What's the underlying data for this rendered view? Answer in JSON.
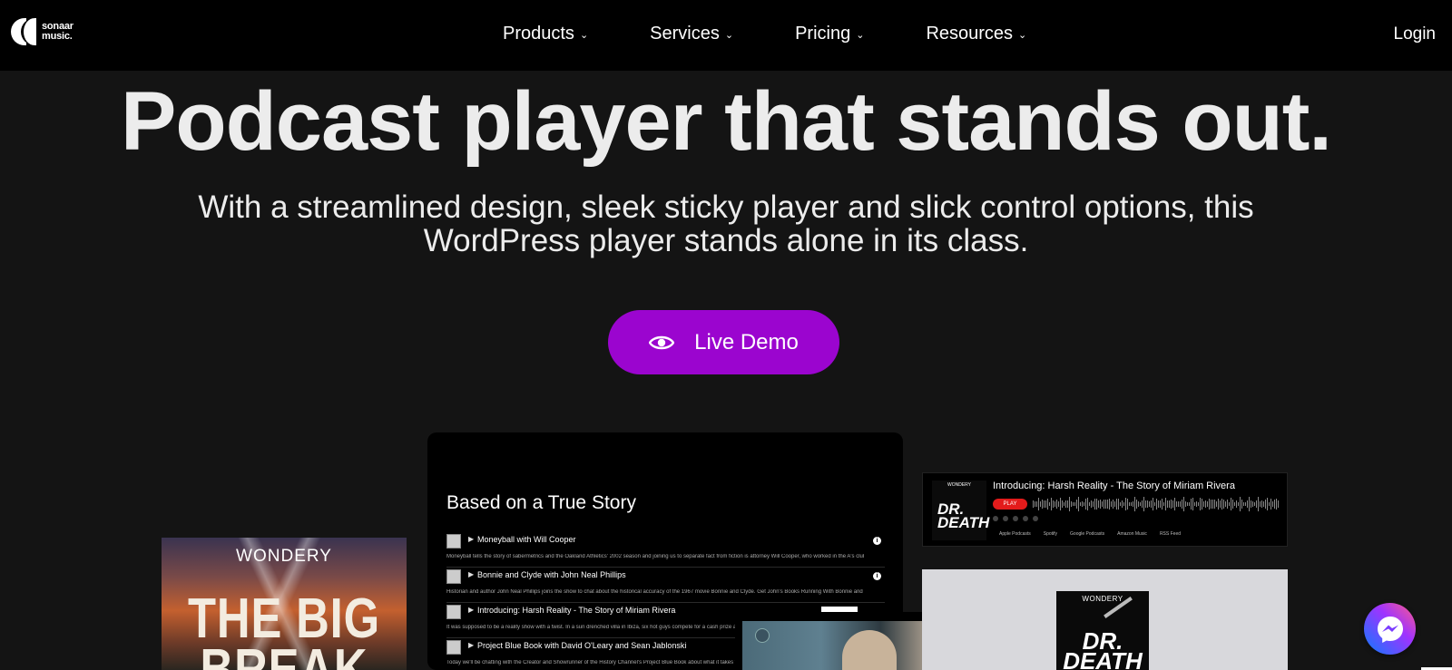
{
  "brand": {
    "name_line1": "sonaar",
    "name_line2": "music."
  },
  "nav": {
    "items": [
      {
        "label": "Products"
      },
      {
        "label": "Services"
      },
      {
        "label": "Pricing"
      },
      {
        "label": "Resources"
      }
    ],
    "login_label": "Login"
  },
  "hero": {
    "title": "Podcast player that stands out.",
    "subtitle_line1": "With a streamlined design, sleek sticky player and slick control options, this",
    "subtitle_line2": "WordPress player stands alone in its class.",
    "cta_label": "Live Demo",
    "cta_color": "#9b05cf"
  },
  "showcase": {
    "left_card": {
      "brand": "WONDERY",
      "title_line1": "THE BIG",
      "title_line2": "BREAK"
    },
    "center_card": {
      "title": "Based on a True Story",
      "episodes": [
        {
          "title": "Moneyball with Will Cooper",
          "desc": "Moneyball tells the story of sabermetrics and the Oakland Athletics' 2002 season and joining us to separate fact from fiction is attorney Will Cooper, who worked in the A's clubhouse during [...]"
        },
        {
          "title": "Bonnie and Clyde with John Neal Phillips",
          "desc": "Historian and author John Neal Phillips joins the show to chat about the historical accuracy of the 1967 movie Bonnie and Clyde. Get John's Books Running With Bonnie and Clyde: The [...]"
        },
        {
          "title": "Introducing: Harsh Reality - The Story of Miriam Rivera",
          "desc": "It was supposed to be a reality show with a twist. In a sun drenched villa in Ibiza, six hot guys compete for a cash prize and for the love"
        },
        {
          "title": "Project Blue Book with David O'Leary and Sean Jablonski",
          "desc": "Today we'll be chatting with the Creator and Showrunner of the History Channel's Project Blue Book about what it takes to create a TV"
        }
      ]
    },
    "right_top_card": {
      "cover_brand": "WONDERY",
      "cover_title_line1": "DR.",
      "cover_title_line2": "DEATH",
      "episode_title": "Introducing: Harsh Reality - The Story of Miriam Rivera",
      "play_label": "PLAY",
      "platforms": [
        "Apple Podcasts",
        "Spotify",
        "Google Podcasts",
        "Amazon Music",
        "RSS Feed"
      ]
    },
    "right_bottom_card": {
      "cover_brand": "WONDERY",
      "cover_title_line1": "DR.",
      "cover_title_line2": "DEATH"
    }
  },
  "icons": {
    "eye": "eye-icon",
    "messenger": "messenger-icon",
    "chevron": "chevron-down-icon",
    "info": "info-icon"
  }
}
